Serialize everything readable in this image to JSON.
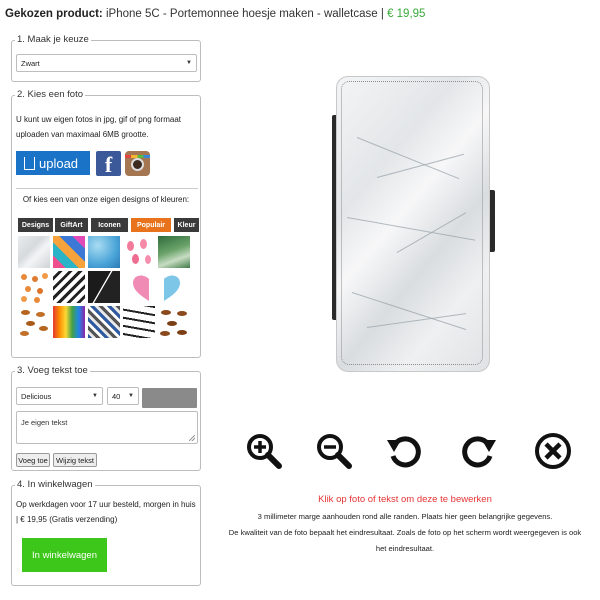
{
  "header": {
    "label": "Gekozen product:",
    "product": "iPhone 5C - Portemonnee hoesje maken - walletcase",
    "separator": "|",
    "price": "€ 19,95",
    "price_color": "#3aa83a"
  },
  "step1": {
    "title": "1. Maak je keuze",
    "select_value": "Zwart"
  },
  "step2": {
    "title": "2. Kies een foto",
    "description": "U kunt uw eigen fotos in jpg, gif of png formaat uploaden van maximaal 6MB grootte.",
    "upload_label": "upload",
    "facebook_label": "f",
    "or_text": "Of kies een van onze eigen designs of kleuren:",
    "tabs": [
      "Designs",
      "GiftArt",
      "Iconen",
      "Populair",
      "Kleur"
    ],
    "active_tab": "Populair",
    "accent_color": "#e8731c",
    "tiles": [
      "marble",
      "palm-leaves",
      "ice-blue",
      "flamingos",
      "jungle-leaves",
      "clover-pattern",
      "chevron",
      "black-marble",
      "heart-half-pink",
      "heart-half-blue",
      "lips-pattern",
      "paint-drip",
      "herringbone",
      "brush-strokes",
      "mustache-pattern"
    ]
  },
  "step3": {
    "title": "3. Voeg tekst toe",
    "font_value": "Delicious",
    "size_value": "40",
    "textarea_value": "Je eigen tekst",
    "add_label": "Voeg toe",
    "edit_label": "Wijzig tekst"
  },
  "step4": {
    "title": "4. In winkelwagen",
    "description": "Op werkdagen voor 17 uur besteld, morgen in huis | € 19,95 (Gratis verzending)",
    "cart_label": "In winkelwagen",
    "cart_color": "#3dc71a"
  },
  "preview": {
    "design": "white-marble"
  },
  "tools": [
    "zoom-in",
    "zoom-out",
    "rotate-left",
    "rotate-right",
    "remove"
  ],
  "info": {
    "hint": "Klik op foto of tekst om deze te bewerken",
    "margin_note": "3 millimeter marge aanhouden rond alle randen. Plaats hier geen belangrijke gegevens.",
    "quality_note_1": "De kwaliteit van de foto bepaalt het eindresultaat. Zoals de foto op het scherm wordt weergegeven is ook",
    "quality_note_2": "het eindresultaat."
  }
}
